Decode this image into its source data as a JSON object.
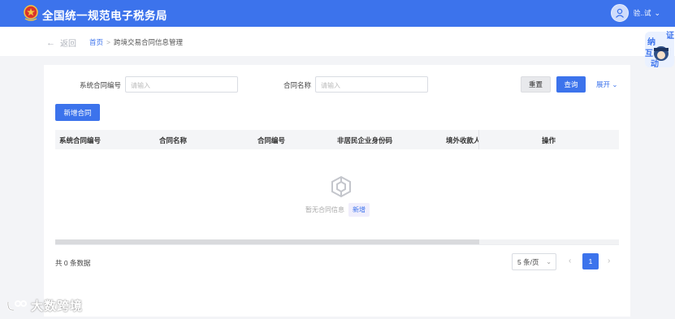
{
  "header": {
    "title": "全国统一规范电子税务局",
    "user_name": "验..试",
    "icons": {
      "emblem": "tax-emblem-icon",
      "avatar": "user-avatar-icon",
      "dropdown": "chevron-down-icon"
    }
  },
  "breadcrumb": {
    "back_label": "返回",
    "home": "首页",
    "separator": ">",
    "current": "跨境交易合同信息管理"
  },
  "float_badge": {
    "chars": [
      "证",
      "纳",
      "互",
      "动"
    ]
  },
  "search": {
    "field1_label": "系统合同编号",
    "field1_placeholder": "请输入",
    "field2_label": "合同名称",
    "field2_placeholder": "请输入",
    "reset_label": "重置",
    "query_label": "查询",
    "expand_label": "展开"
  },
  "toolbar": {
    "add_label": "新增合同"
  },
  "table": {
    "columns": [
      "系统合同编号",
      "合同名称",
      "合同编号",
      "非居民企业身份码",
      "境外收款人",
      "操作"
    ],
    "empty_text": "暂无合同信息",
    "empty_add": "新增"
  },
  "pagination": {
    "total_text": "共 0 条数据",
    "page_size": "5 条/页",
    "current_page": "1"
  },
  "watermark": {
    "text": "大数跨境"
  },
  "colors": {
    "primary": "#3c73ec",
    "page_bg": "#f3f4f7",
    "header_bg": "#f4f5f7"
  }
}
